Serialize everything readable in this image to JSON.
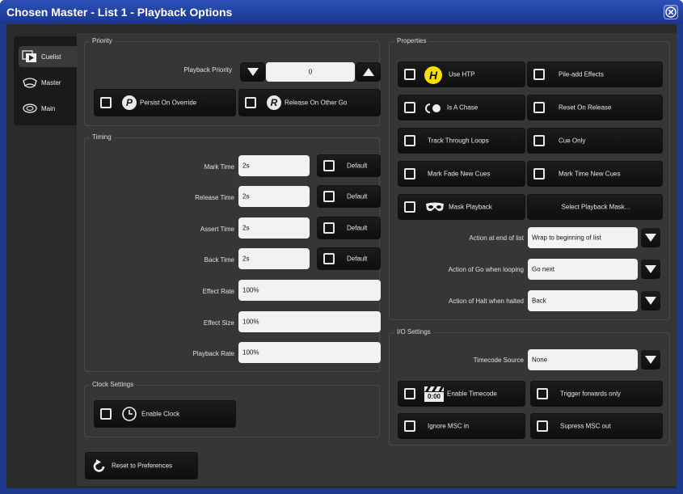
{
  "window": {
    "title": "Chosen Master - List 1 - Playback Options"
  },
  "tabs": [
    {
      "label": "Cuelist",
      "icon": "cuelist-icon"
    },
    {
      "label": "Master",
      "icon": "master-icon"
    },
    {
      "label": "Main",
      "icon": "main-icon"
    }
  ],
  "priority": {
    "title": "Priority",
    "playback_label": "Playback Priority",
    "value": "0",
    "persist_label": "Persist On Override",
    "release_label": "Release On Other Go"
  },
  "timing": {
    "title": "Timing",
    "rows": [
      {
        "label": "Mark Time",
        "value": "2s",
        "default_label": "Default"
      },
      {
        "label": "Release Time",
        "value": "2s",
        "default_label": "Default"
      },
      {
        "label": "Assert Time",
        "value": "2s",
        "default_label": "Default"
      },
      {
        "label": "Back Time",
        "value": "2s",
        "default_label": "Default"
      }
    ],
    "effect_rate_label": "Effect Rate",
    "effect_rate": "100%",
    "effect_size_label": "Effect Size",
    "effect_size": "100%",
    "playback_rate_label": "Playback Rate",
    "playback_rate": "100%"
  },
  "clock": {
    "title": "Clock Settings",
    "enable_label": "Enable Clock"
  },
  "reset_label": "Reset to Preferences",
  "properties": {
    "title": "Properties",
    "use_htp": "Use HTP",
    "pile_add": "Pile-add Effects",
    "is_chase": "Is A Chase",
    "reset_on_release": "Reset On Release",
    "track_through_loops": "Track Through Loops",
    "cue_only": "Cue Only",
    "mark_fade_new_cues": "Mark Fade New Cues",
    "mark_time_new_cues": "Mark Time New Cues",
    "mask_playback": "Mask Playback",
    "select_mask": "Select Playback Mask...",
    "action_end_label": "Action at end of list",
    "action_end_value": "Wrap to beginning of list",
    "action_go_label": "Action of Go when looping",
    "action_go_value": "Go next",
    "action_halt_label": "Action of Halt when halted",
    "action_halt_value": "Back"
  },
  "io": {
    "title": "I/O Settings",
    "timecode_label": "Timecode Source",
    "timecode_value": "None",
    "enable_timecode": "Enable Timecode",
    "trigger_forwards": "Trigger forwards only",
    "ignore_msc": "Ignore MSC in",
    "supress_msc": "Supress MSC out",
    "timecode_icon_text": "0:00"
  }
}
